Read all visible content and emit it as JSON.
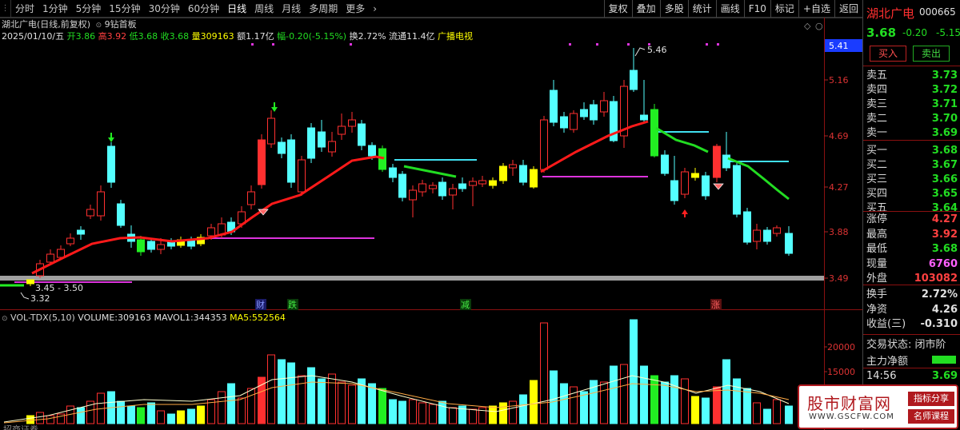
{
  "toolbar": {
    "periods": [
      "分时",
      "1分钟",
      "5分钟",
      "15分钟",
      "30分钟",
      "60分钟",
      "日线",
      "周线",
      "月线",
      "多周期",
      "更多"
    ],
    "active_period": "日线",
    "more_arrow": "›",
    "tools": [
      "复权",
      "叠加",
      "多股",
      "统计",
      "画线",
      "F10",
      "标记",
      "+自选",
      "返回"
    ]
  },
  "info": {
    "title": "湖北广电(日线,前复权)",
    "indicator_name": "9钻首板",
    "date": "2025/01/10/五",
    "open_label": "开",
    "open": "3.86",
    "high_label": "高",
    "high": "3.92",
    "low_label": "低",
    "low": "3.68",
    "close_label": "收",
    "close": "3.68",
    "volume_label": "量",
    "volume": "309163",
    "amount_label": "额",
    "amount": "1.17亿",
    "change_label": "幅",
    "change": "-0.20(-5.15%)",
    "turnover_label": "换",
    "turnover": "2.72%",
    "float_label": "流通",
    "float": "11.4亿",
    "sector": "广播电视"
  },
  "price_axis": {
    "ticks": [
      "5.41",
      "5.16",
      "4.69",
      "4.27",
      "3.88",
      "3.49"
    ],
    "current": "5.41"
  },
  "annotations": {
    "peak": "5.46",
    "low": "3.32",
    "range": "3.45 - 3.50",
    "event_tags": [
      "财",
      "跌",
      "减",
      "涨"
    ]
  },
  "vol": {
    "name": "VOL-TDX(5,10)",
    "volume_label": "VOLUME:",
    "volume": "309163",
    "mavol1_label": "MAVOL1:",
    "mavol1": "344353",
    "ma5_label": "MA5:",
    "ma5": "552564",
    "ticks": [
      "20000",
      "15000",
      "10000"
    ],
    "bottom_partial": "招商证券"
  },
  "panel": {
    "name": "湖北广电",
    "code": "000665",
    "price": "3.68",
    "change": "-0.20",
    "change_pct": "-5.15",
    "buy_btn": "买入",
    "sell_btn": "卖出",
    "asks": [
      {
        "label": "卖五",
        "price": "3.73"
      },
      {
        "label": "卖四",
        "price": "3.72"
      },
      {
        "label": "卖三",
        "price": "3.71"
      },
      {
        "label": "卖二",
        "price": "3.70"
      },
      {
        "label": "卖一",
        "price": "3.69"
      }
    ],
    "bids": [
      {
        "label": "买一",
        "price": "3.68"
      },
      {
        "label": "买二",
        "price": "3.67"
      },
      {
        "label": "买三",
        "price": "3.66"
      },
      {
        "label": "买四",
        "price": "3.65"
      },
      {
        "label": "买五",
        "price": "3.64"
      }
    ],
    "stats": [
      {
        "label": "涨停",
        "value": "4.27",
        "color": "#ff4040"
      },
      {
        "label": "最高",
        "value": "3.92",
        "color": "#ff4040"
      },
      {
        "label": "最低",
        "value": "3.68",
        "color": "#22dd22"
      },
      {
        "label": "现量",
        "value": "6760",
        "color": "#ff60ff"
      },
      {
        "label": "外盘",
        "value": "103082",
        "color": "#ff4040"
      }
    ],
    "stats2": [
      {
        "label": "换手",
        "value": "2.72%",
        "color": "#e0e0e0"
      },
      {
        "label": "净资",
        "value": "4.26",
        "color": "#e0e0e0"
      },
      {
        "label": "收益(三)",
        "value": "-0.310",
        "color": "#e0e0e0"
      }
    ],
    "trade_status": "交易状态: 闭市阶",
    "main_net": "主力净额",
    "time": "14:56",
    "time_price": "3.69"
  },
  "watermark": {
    "title": "股市财富网",
    "url": "WWW.GSCFW.COM",
    "tag1": "指标分享",
    "tag2": "名师课程"
  },
  "colors": {
    "up": "#ff3030",
    "down": "#54ffff",
    "flat": "#ffff00",
    "green_candle": "#22ee22",
    "ma_red": "#ff1a1a",
    "ma_green": "#22dd22",
    "level_magenta": "#dd33dd",
    "level_cyan": "#40e0f0"
  }
}
